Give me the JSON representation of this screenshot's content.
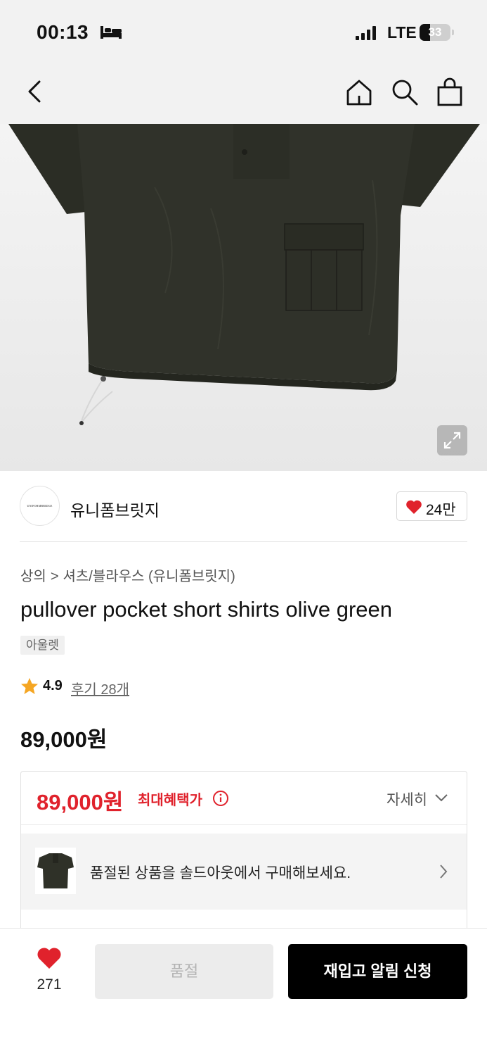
{
  "status_bar": {
    "time": "00:13",
    "network": "LTE",
    "battery": "33",
    "battery_level_percent": 33
  },
  "brand": {
    "logo_text": "UNIFORMBRIDGE",
    "name": "유니폼브릿지",
    "like_count": "24만"
  },
  "breadcrumb": {
    "level1": "상의",
    "separator": ">",
    "level2": "셔츠/블라우스 (유니폼브릿지)"
  },
  "product": {
    "title": "pullover pocket short shirts olive green",
    "badge": "아울렛",
    "rating": "4.9",
    "review_link": "후기 28개",
    "price": "89,000원"
  },
  "benefit": {
    "price": "89,000원",
    "label": "최대혜택가",
    "detail_label": "자세히",
    "soldout_message": "품절된 상품을 솔드아웃에서 구매해보세요."
  },
  "bottom_bar": {
    "wish_count": "271",
    "soldout_label": "품절",
    "restock_label": "재입고 알림 신청"
  },
  "colors": {
    "accent_red": "#e0222c",
    "primary_black": "#000000",
    "shirt_olive": "#2f3128"
  },
  "icons": [
    "bed-icon",
    "signal-icon",
    "battery-icon",
    "back-icon",
    "home-icon",
    "search-icon",
    "shopping-bag-icon",
    "expand-icon",
    "heart-icon",
    "star-icon",
    "info-icon",
    "chevron-down-icon",
    "chevron-right-icon"
  ]
}
